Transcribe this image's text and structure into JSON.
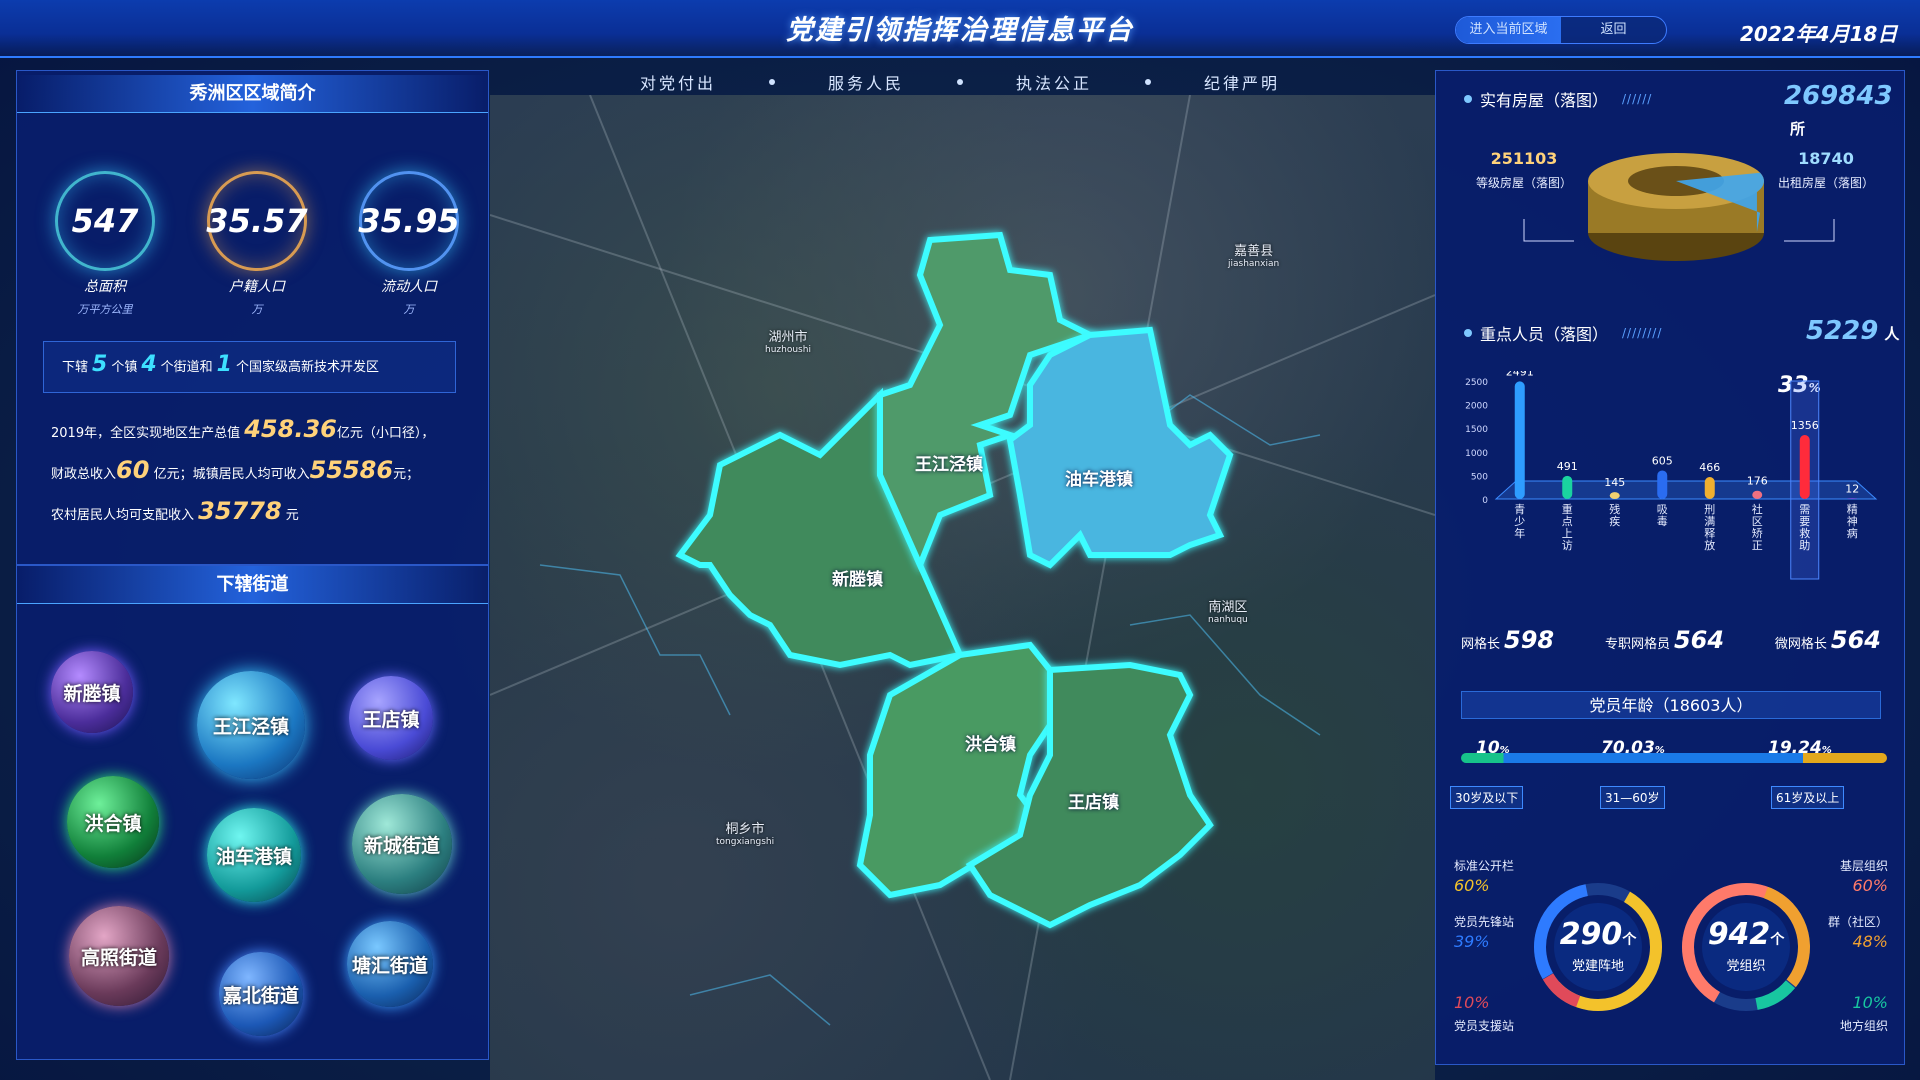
{
  "header": {
    "title": "党建引领指挥治理信息平台",
    "btn_enter": "进入当前区域",
    "btn_back": "返回",
    "date": "2022年4月18日"
  },
  "slogans": [
    "对党付出",
    "服务人民",
    "执法公正",
    "纪律严明"
  ],
  "intro": {
    "title": "秀洲区区域简介",
    "stats": [
      {
        "value": "547",
        "label": "总面积",
        "unit": "万平方公里"
      },
      {
        "value": "35.57",
        "label": "户籍人口",
        "unit": "万"
      },
      {
        "value": "35.95",
        "label": "流动人口",
        "unit": "万"
      }
    ],
    "summary": {
      "p1": "下辖",
      "n1": "5",
      "p2": "个镇",
      "n2": "4",
      "p3": "个街道和",
      "n3": "1",
      "p4": "个国家级高新技术开发区"
    },
    "econ": {
      "l1a": "2019年，全区实现地区生产总值",
      "v1": "458.36",
      "l1b": "亿元（小口径），",
      "l2a": "财政总收入",
      "v2": "60",
      "l2b": "亿元；城镇居民人均可收入",
      "v3": "55586",
      "l2c": "元；",
      "l3a": "农村居民人均可支配收入",
      "v4": "35778",
      "l3b": "元"
    }
  },
  "streets": {
    "title": "下辖街道",
    "items": [
      "新塍镇",
      "王江泾镇",
      "王店镇",
      "洪合镇",
      "油车港镇",
      "新城街道",
      "高照街道",
      "嘉北街道",
      "塘汇街道"
    ]
  },
  "map": {
    "towns": [
      "王江泾镇",
      "油车港镇",
      "新塍镇",
      "洪合镇",
      "王店镇"
    ],
    "places": [
      {
        "name": "嘉善县",
        "pinyin": "jiashanxian"
      },
      {
        "name": "湖州市",
        "pinyin": "huzhoushi"
      },
      {
        "name": "南湖区",
        "pinyin": "nanhuqu"
      },
      {
        "name": "桐乡市",
        "pinyin": "tongxiangshi"
      }
    ]
  },
  "housing": {
    "title": "实有房屋（落图）",
    "total": "269843",
    "unit": "所",
    "graded_value": "251103",
    "graded_label": "等级房屋（落图）",
    "rent_value": "18740",
    "rent_label": "出租房屋（落图）",
    "rent_ratio": 0.07
  },
  "key_people": {
    "title": "重点人员（落图）",
    "total": "5229",
    "unit": "人",
    "highlight_pct": "33",
    "pct_sign": "%"
  },
  "chart_data": {
    "type": "bar",
    "categories": [
      "青少年",
      "重点上访",
      "残疾",
      "吸毒",
      "刑满释放",
      "社区矫正",
      "需要救助",
      "精神病"
    ],
    "values": [
      2491,
      491,
      145,
      605,
      466,
      176,
      1356,
      12
    ],
    "ylim": [
      0,
      2500
    ],
    "yticks": [
      0,
      500,
      1000,
      1500,
      2000,
      2500
    ],
    "colors": [
      "#2e9dff",
      "#1ad3a0",
      "#f0d070",
      "#2a6cf0",
      "#f0b030",
      "#f07080",
      "#ff2b3b",
      "#a25bff"
    ],
    "highlight_index": 6
  },
  "grid": {
    "l1": "网格长",
    "v1": "598",
    "l2": "专职网格员",
    "v2": "564",
    "l3": "微网格长",
    "v3": "564"
  },
  "age": {
    "title": "党员年龄（18603人）",
    "p1": "10",
    "p2": "70.03",
    "p3": "19.24",
    "pct": "%",
    "t1": "30岁及以下",
    "t2": "31—60岁",
    "t3": "61岁及以上"
  },
  "donut1": {
    "value": "290",
    "unit": "个",
    "label": "党建阵地",
    "s1": "标准公开栏",
    "p1": "60%",
    "s2": "党员先锋站",
    "p2": "39%",
    "s3": "党员支援站",
    "p3": "10%"
  },
  "donut2": {
    "value": "942",
    "unit": "个",
    "label": "党组织",
    "s1": "基层组织",
    "p1": "60%",
    "s2": "群（社区）",
    "p2": "48%",
    "s3": "地方组织",
    "p3": "10%"
  },
  "colors": {
    "accent": "#3de0ff",
    "gold": "#ffd27a",
    "panel": "#081e6e"
  }
}
